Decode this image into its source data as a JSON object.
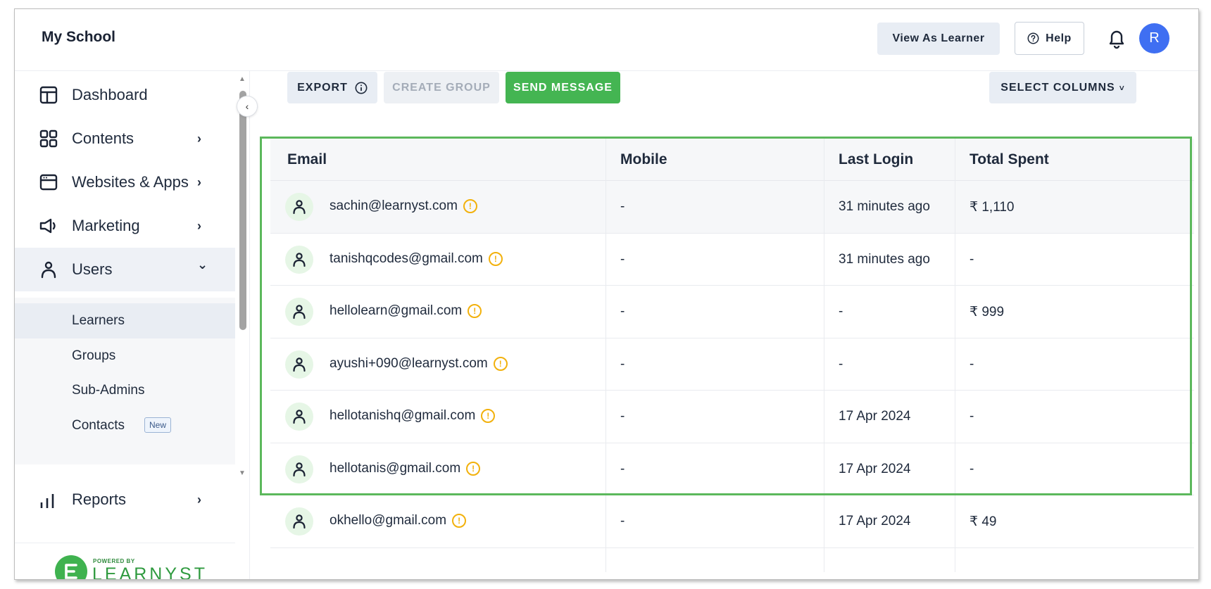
{
  "header": {
    "title": "My School",
    "view_as_learner": "View As Learner",
    "help": "Help",
    "avatar_initial": "R"
  },
  "sidebar": {
    "items": [
      {
        "label": "Dashboard",
        "icon": "dashboard-icon"
      },
      {
        "label": "Contents",
        "icon": "grid-icon",
        "chevron": "›"
      },
      {
        "label": "Websites & Apps",
        "icon": "browser-icon",
        "chevron": "›"
      },
      {
        "label": "Marketing",
        "icon": "megaphone-icon",
        "chevron": "›"
      },
      {
        "label": "Users",
        "icon": "user-icon",
        "chevron": "⌄"
      },
      {
        "label": "Reports",
        "icon": "bar-chart-icon",
        "chevron": "›"
      }
    ],
    "sub_items": [
      {
        "label": "Learners"
      },
      {
        "label": "Groups"
      },
      {
        "label": "Sub-Admins"
      },
      {
        "label": "Contacts",
        "badge": "New"
      }
    ],
    "footer": {
      "powered_by": "POWERED BY",
      "brand": "LEARNYST"
    }
  },
  "toolbar": {
    "export": "EXPORT",
    "create_group": "CREATE GROUP",
    "send_message": "SEND MESSAGE",
    "select_columns": "SELECT COLUMNS"
  },
  "table": {
    "columns": [
      "Email",
      "Mobile",
      "Last Login",
      "Total Spent"
    ],
    "rows": [
      {
        "email": "sachin@learnyst.com",
        "mobile": "-",
        "last_login": "31 minutes ago",
        "total_spent": "₹ 1,110"
      },
      {
        "email": "tanishqcodes@gmail.com",
        "mobile": "-",
        "last_login": "31 minutes ago",
        "total_spent": "-"
      },
      {
        "email": "hellolearn@gmail.com",
        "mobile": "-",
        "last_login": "-",
        "total_spent": "₹ 999"
      },
      {
        "email": "ayushi+090@learnyst.com",
        "mobile": "-",
        "last_login": "-",
        "total_spent": "-"
      },
      {
        "email": "hellotanishq@gmail.com",
        "mobile": "-",
        "last_login": "17 Apr 2024",
        "total_spent": "-"
      },
      {
        "email": "hellotanis@gmail.com",
        "mobile": "-",
        "last_login": "17 Apr 2024",
        "total_spent": "-"
      },
      {
        "email": "okhello@gmail.com",
        "mobile": "-",
        "last_login": "17 Apr 2024",
        "total_spent": "₹ 49"
      }
    ]
  },
  "colors": {
    "accent_green": "#44b552",
    "avatar_blue": "#3f6ff2",
    "warning": "#f2b10c",
    "highlight_box": "#5cb85c"
  }
}
